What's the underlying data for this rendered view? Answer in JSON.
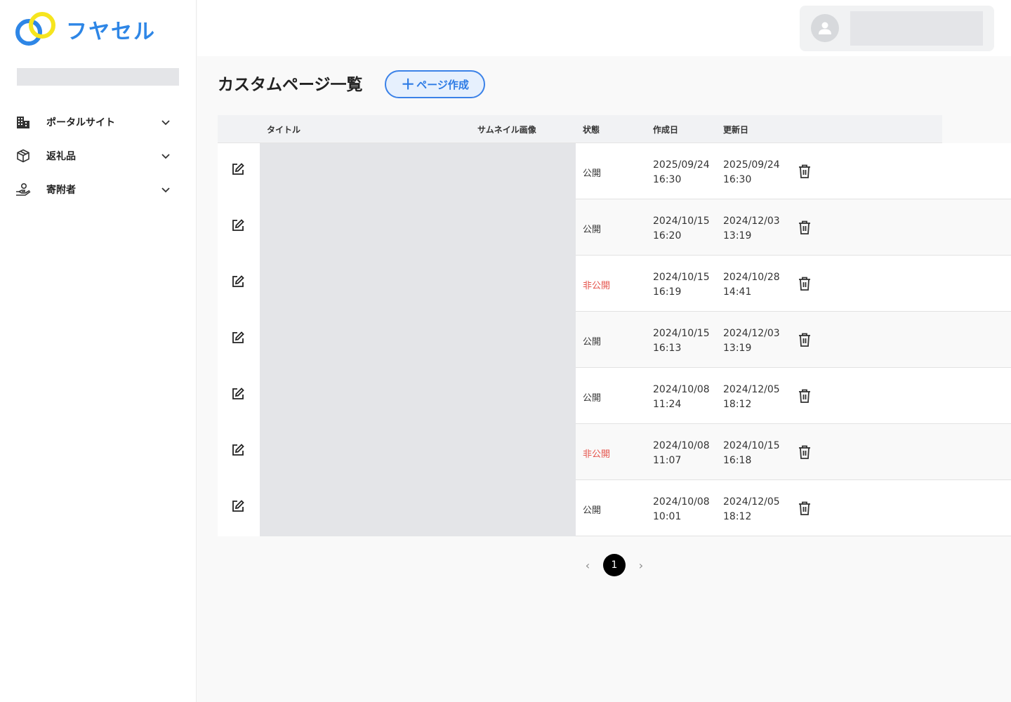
{
  "app": {
    "logo_text": "フヤセル",
    "brand_color": "#2e86e6",
    "accent_yellow": "#f6e51e"
  },
  "sidebar": {
    "items": [
      {
        "label": "ポータルサイト",
        "icon": "building-icon"
      },
      {
        "label": "返礼品",
        "icon": "box-icon"
      },
      {
        "label": "寄附者",
        "icon": "hand-person-icon"
      }
    ]
  },
  "page": {
    "title": "カスタムページ一覧",
    "create_button": "ページ作成",
    "create_plus": "＋"
  },
  "table": {
    "headers": {
      "title": "タイトル",
      "thumbnail": "サムネイル画像",
      "status": "状態",
      "created": "作成日",
      "updated": "更新日"
    },
    "rows": [
      {
        "status": "公開",
        "private": false,
        "created_date": "2025/09/24",
        "created_time": "16:30",
        "updated_date": "2025/09/24",
        "updated_time": "16:30"
      },
      {
        "status": "公開",
        "private": false,
        "created_date": "2024/10/15",
        "created_time": "16:20",
        "updated_date": "2024/12/03",
        "updated_time": "13:19"
      },
      {
        "status": "非公開",
        "private": true,
        "created_date": "2024/10/15",
        "created_time": "16:19",
        "updated_date": "2024/10/28",
        "updated_time": "14:41"
      },
      {
        "status": "公開",
        "private": false,
        "created_date": "2024/10/15",
        "created_time": "16:13",
        "updated_date": "2024/12/03",
        "updated_time": "13:19"
      },
      {
        "status": "公開",
        "private": false,
        "created_date": "2024/10/08",
        "created_time": "11:24",
        "updated_date": "2024/12/05",
        "updated_time": "18:12"
      },
      {
        "status": "非公開",
        "private": true,
        "created_date": "2024/10/08",
        "created_time": "11:07",
        "updated_date": "2024/10/15",
        "updated_time": "16:18"
      },
      {
        "status": "公開",
        "private": false,
        "created_date": "2024/10/08",
        "created_time": "10:01",
        "updated_date": "2024/12/05",
        "updated_time": "18:12"
      }
    ]
  },
  "pagination": {
    "current": "1",
    "prev": "‹",
    "next": "›"
  }
}
